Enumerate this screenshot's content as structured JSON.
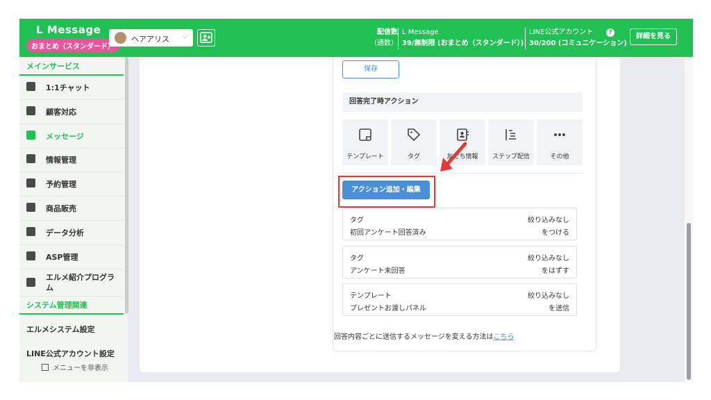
{
  "header": {
    "brand": "L Message",
    "plan_badge": "おまとめ（スタンダード）",
    "account_name": "ヘアアリス",
    "stats": {
      "sent_label": "配信数",
      "sent_sub": "（通数）",
      "plan_name": "L Message",
      "plan_value": "39/無制限 (おまとめ（スタンダード）)",
      "line_label": "LINE公式アカウント",
      "line_value": "30/200 (コミュニケーション)"
    },
    "help_icon": "?",
    "detail_button": "詳細を見る"
  },
  "sidebar": {
    "main_section": "メインサービス",
    "items": [
      {
        "label": "1:1チャット",
        "icon": "chat-icon"
      },
      {
        "label": "顧客対応",
        "icon": "customer-icon"
      },
      {
        "label": "メッセージ",
        "icon": "message-icon",
        "active": true
      },
      {
        "label": "情報管理",
        "icon": "tag-icon"
      },
      {
        "label": "予約管理",
        "icon": "calendar-icon"
      },
      {
        "label": "商品販売",
        "icon": "cart-icon"
      },
      {
        "label": "データ分析",
        "icon": "chart-icon"
      },
      {
        "label": "ASP管理",
        "icon": "asp-icon"
      },
      {
        "label": "エルメ紹介プログラム",
        "icon": "badge-icon"
      }
    ],
    "system_section": "システム管理関連",
    "system_items": [
      "エルメシステム設定",
      "LINE公式アカウント設定"
    ],
    "hide_menu": "メニューを非表示"
  },
  "main": {
    "save_button": "保存",
    "action_heading": "回答完了時アクション",
    "tiles": [
      "テンプレート",
      "タグ",
      "友だち情報",
      "ステップ配信",
      "その他"
    ],
    "add_action_button": "アクション追加・編集",
    "rules": [
      {
        "type": "タグ",
        "detail": "初回アンケート回答済み",
        "filter": "絞り込みなし",
        "action": "をつける"
      },
      {
        "type": "タグ",
        "detail": "アンケート未回答",
        "filter": "絞り込みなし",
        "action": "をはずす"
      },
      {
        "type": "テンプレート",
        "detail": "プレゼントお渡しパネル",
        "filter": "絞り込みなし",
        "action": "を送信"
      }
    ],
    "footnote_text": "回答内容ごとに送信するメッセージを変える方法は",
    "footnote_link": "こちら"
  },
  "colors": {
    "brand_green": "#22bf55",
    "accent_blue": "#4a90d9",
    "highlight_red": "#e53935",
    "badge_pink": "#e7559c"
  }
}
